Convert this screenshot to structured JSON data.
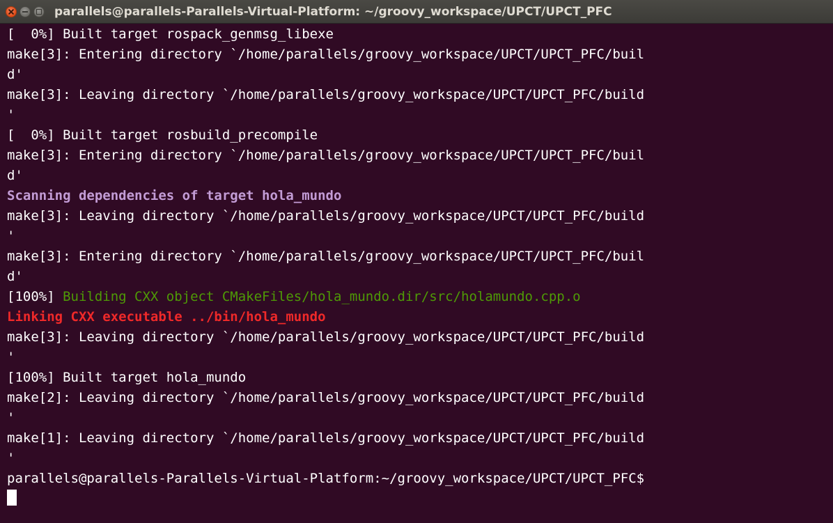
{
  "window": {
    "title": "parallels@parallels-Parallels-Virtual-Platform: ~/groovy_workspace/UPCT/UPCT_PFC",
    "buttons": {
      "close": "close",
      "minimize": "minimize",
      "maximize": "maximize"
    }
  },
  "terminal": {
    "lines": [
      {
        "text": "[  0%] Built target rospack_genmsg_libexe",
        "style": "normal"
      },
      {
        "text": "make[3]: Entering directory `/home/parallels/groovy_workspace/UPCT/UPCT_PFC/buil",
        "style": "normal"
      },
      {
        "text": "d'",
        "style": "normal"
      },
      {
        "text": "make[3]: Leaving directory `/home/parallels/groovy_workspace/UPCT/UPCT_PFC/build",
        "style": "normal"
      },
      {
        "text": "'",
        "style": "normal"
      },
      {
        "text": "[  0%] Built target rosbuild_precompile",
        "style": "normal"
      },
      {
        "text": "make[3]: Entering directory `/home/parallels/groovy_workspace/UPCT/UPCT_PFC/buil",
        "style": "normal"
      },
      {
        "text": "d'",
        "style": "normal"
      },
      {
        "text": "Scanning dependencies of target hola_mundo",
        "style": "purple"
      },
      {
        "text": "make[3]: Leaving directory `/home/parallels/groovy_workspace/UPCT/UPCT_PFC/build",
        "style": "normal"
      },
      {
        "text": "'",
        "style": "normal"
      },
      {
        "text": "make[3]: Entering directory `/home/parallels/groovy_workspace/UPCT/UPCT_PFC/buil",
        "style": "normal"
      },
      {
        "text": "d'",
        "style": "normal"
      },
      {
        "text": "[100%] ",
        "style": "normal",
        "suffix": "Building CXX object CMakeFiles/hola_mundo.dir/src/holamundo.cpp.o",
        "suffix_style": "green"
      },
      {
        "text": "Linking CXX executable ../bin/hola_mundo",
        "style": "red"
      },
      {
        "text": "make[3]: Leaving directory `/home/parallels/groovy_workspace/UPCT/UPCT_PFC/build",
        "style": "normal"
      },
      {
        "text": "'",
        "style": "normal"
      },
      {
        "text": "[100%] Built target hola_mundo",
        "style": "normal"
      },
      {
        "text": "make[2]: Leaving directory `/home/parallels/groovy_workspace/UPCT/UPCT_PFC/build",
        "style": "normal"
      },
      {
        "text": "'",
        "style": "normal"
      },
      {
        "text": "make[1]: Leaving directory `/home/parallels/groovy_workspace/UPCT/UPCT_PFC/build",
        "style": "normal"
      },
      {
        "text": "'",
        "style": "normal"
      },
      {
        "text": "parallels@parallels-Parallels-Virtual-Platform:~/groovy_workspace/UPCT/UPCT_PFC$",
        "style": "normal"
      }
    ],
    "colors": {
      "background": "#300a24",
      "foreground": "#ffffff",
      "purple": "#c39cd6",
      "green": "#4e9a06",
      "red": "#ef2929"
    }
  }
}
